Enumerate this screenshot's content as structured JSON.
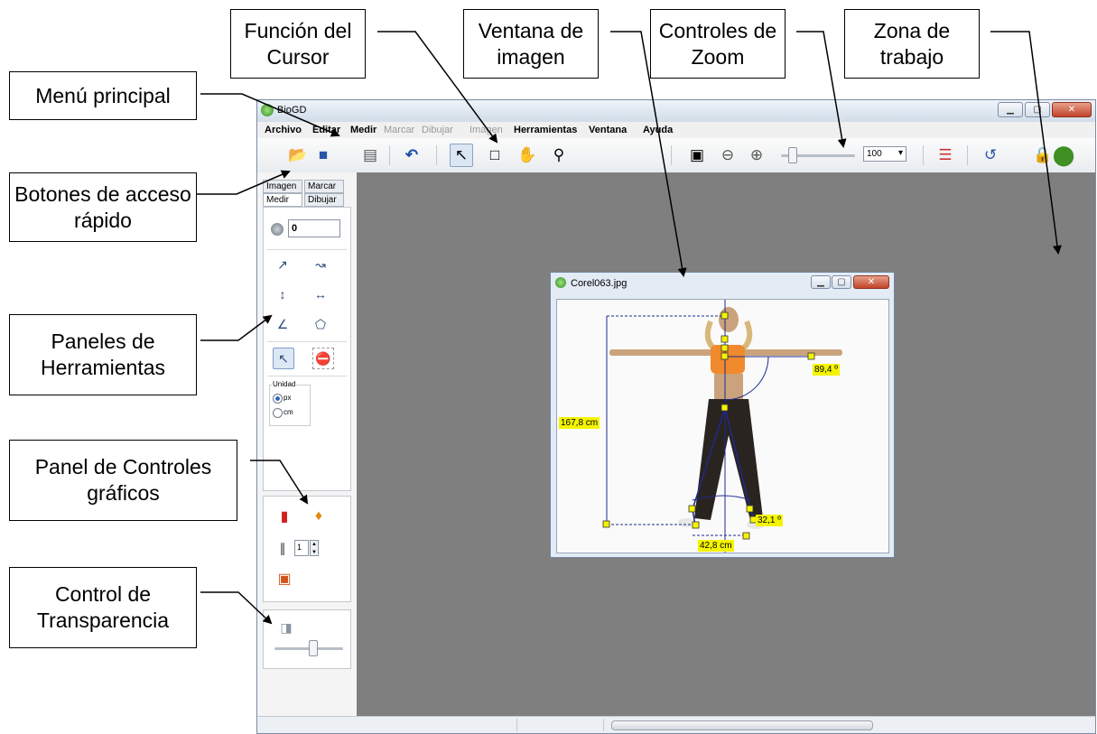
{
  "callouts": {
    "funcion_cursor": "Función del Cursor",
    "ventana_imagen": "Ventana de imagen",
    "controles_zoom": "Controles de Zoom",
    "zona_trabajo": "Zona de trabajo",
    "menu_principal": "Menú principal",
    "botones_acceso": "Botones de acceso rápido",
    "paneles_herramientas": "Paneles de Herramientas",
    "panel_controles": "Panel de Controles gráficos",
    "control_transparencia": "Control de Transparencia"
  },
  "app": {
    "title": "BioGD",
    "menu": [
      "Archivo",
      "Editar",
      "Medir",
      "Marcar",
      "Dibujar",
      "Imagen",
      "Herramientas",
      "Ventana",
      "Ayuda"
    ],
    "zoom_value": "100"
  },
  "left_panel": {
    "tabs": [
      "Imagen",
      "Marcar",
      "Medir",
      "Dibujar"
    ],
    "counter_value": "0",
    "unidad_label": "Unidad",
    "unit_px": "px",
    "unit_cm": "cm",
    "stroke_value": "1"
  },
  "image_window": {
    "title": "Corel063.jpg",
    "labels": {
      "angle1": "89,4 º",
      "height": "167,8 cm",
      "angle2": "32,1 º",
      "width": "42,8 cm"
    }
  },
  "icons": [
    "open-folder-icon",
    "save-icon",
    "camera-icon",
    "undo-icon",
    "pointer-icon",
    "rectangle-select-icon",
    "hand-icon",
    "magnifier-icon",
    "zoom-fit-icon",
    "zoom-out-icon",
    "zoom-in-icon",
    "layers-icon",
    "export-icon",
    "lock-icon",
    "bug-icon"
  ],
  "colors": {
    "work_zone": "#7f7f7f",
    "label_highlight": "#f4f400",
    "measure_line": "#1e2a8c"
  }
}
